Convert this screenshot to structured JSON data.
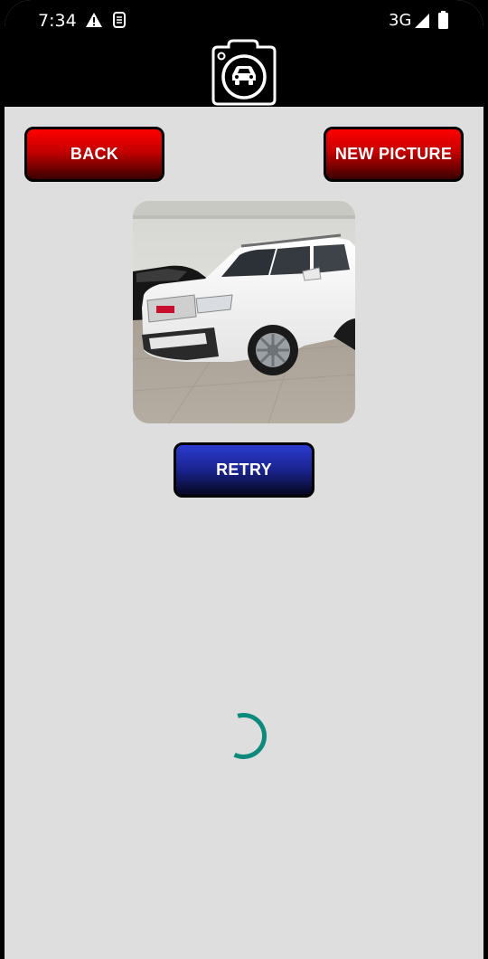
{
  "status_bar": {
    "time": "7:34",
    "network": "3G",
    "icons": [
      "warning-icon",
      "sim-icon",
      "signal-icon",
      "battery-icon"
    ]
  },
  "app_bar": {
    "logo_icon": "camera-car-icon"
  },
  "buttons": {
    "back_label": "BACK",
    "new_picture_label": "NEW PICTURE",
    "retry_label": "RETRY"
  },
  "photo": {
    "subject": "car-photo-image"
  },
  "loading": {
    "indicator": "loading-spinner-icon",
    "color": "#0e8a7d"
  },
  "colors": {
    "background": "#dedede",
    "red_button": "#e00000",
    "blue_button": "#1f2aa8"
  }
}
